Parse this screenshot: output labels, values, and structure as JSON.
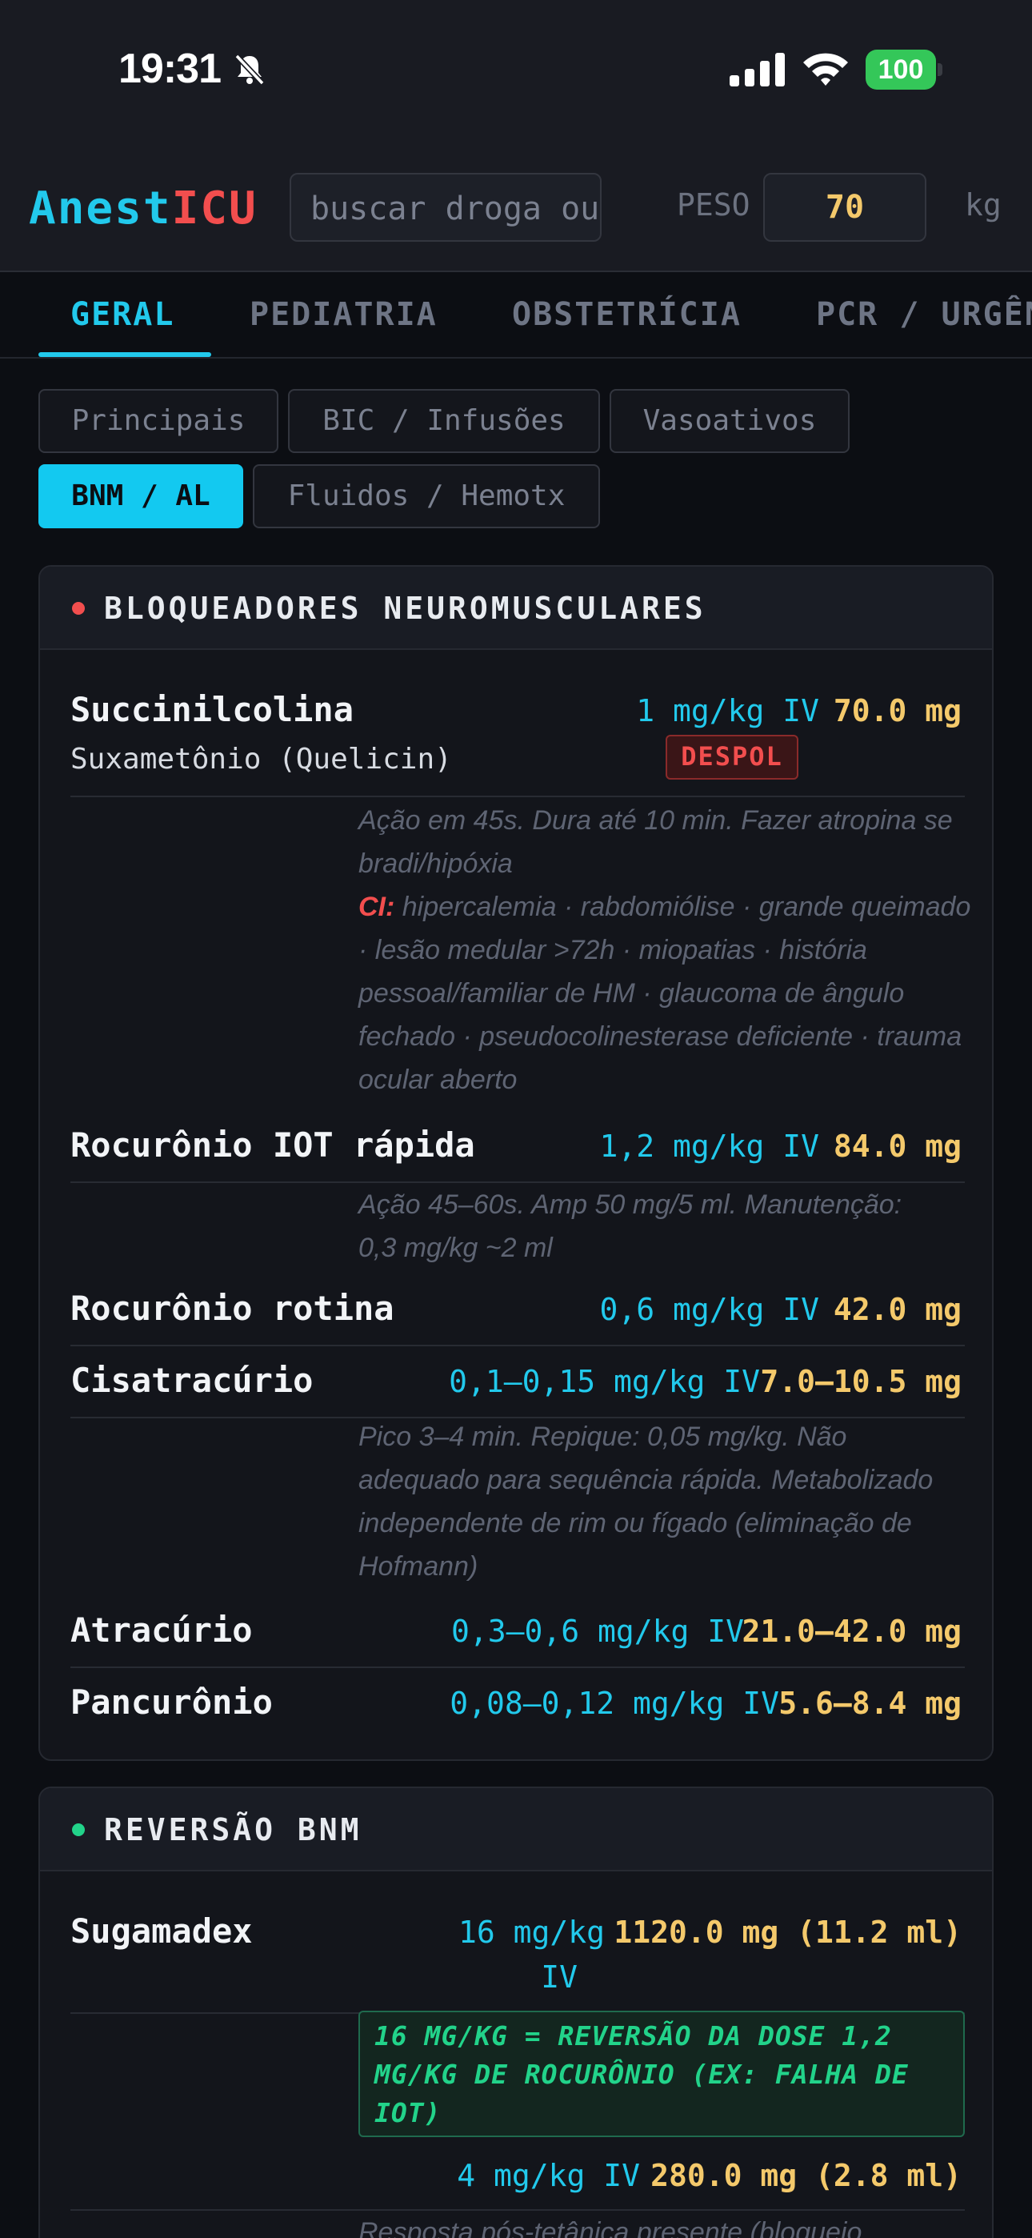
{
  "status_bar": {
    "time": "19:31",
    "battery": "100"
  },
  "header": {
    "logo_part1": "Anest",
    "logo_part2": "ICU",
    "search_placeholder": "buscar droga ou…",
    "weight_label": "PESO",
    "weight_value": "70",
    "weight_unit": "kg"
  },
  "tabs": [
    "GERAL",
    "PEDIATRIA",
    "OBSTETRÍCIA",
    "PCR / URGÊNCIA"
  ],
  "chips": [
    "Principais",
    "BIC / Infusões",
    "Vasoativos",
    "BNM / AL",
    "Fluidos / Hemotx"
  ],
  "active_chip": "BNM / AL",
  "colors": {
    "accent": "#22c9ec",
    "dose": "#f4c96b",
    "alert": "#f24e4e",
    "success": "#22d38a"
  },
  "sections": {
    "bnm": {
      "title": "BLOQUEADORES NEUROMUSCULARES",
      "dot_color": "#f24e4e",
      "drugs": {
        "succinilcolina": {
          "name": "Succinilcolina",
          "brand": "Suxametônio (Quelicin)",
          "dose": "1 mg/kg IV",
          "total": "70.0 mg",
          "badge": "DESPOL",
          "note": "Ação em 45s. Dura até 10 min. Fazer atropina se bradi/hipóxia",
          "ci_label": "CI:",
          "ci_text": " hipercalemia · rabdomiólise · grande queimado · lesão medular >72h · miopatias · história pessoal/familiar de HM · glaucoma de ângulo fechado · pseudocolinesterase deficiente · trauma ocular aberto"
        },
        "rocuronio_rapida": {
          "name": "Rocurônio IOT rápida",
          "dose": "1,2 mg/kg IV",
          "total": "84.0 mg",
          "note": "Ação 45–60s. Amp 50 mg/5 ml. Manutenção: 0,3 mg/kg ~2 ml"
        },
        "rocuronio_rotina": {
          "name": "Rocurônio rotina",
          "dose": "0,6 mg/kg IV",
          "total": "42.0 mg"
        },
        "cisatracurio": {
          "name": "Cisatracúrio",
          "dose": "0,1–0,15 mg/kg IV",
          "total": "7.0–10.5 mg",
          "note": "Pico 3–4 min. Repique: 0,05 mg/kg. Não adequado para sequência rápida. Metabolizado independente de rim ou fígado (eliminação de Hofmann)"
        },
        "atracurio": {
          "name": "Atracúrio",
          "dose": "0,3–0,6 mg/kg IV",
          "total": "21.0–42.0 mg"
        },
        "pancuronio": {
          "name": "Pancurônio",
          "dose": "0,08–0,12 mg/kg IV",
          "total": "5.6–8.4 mg"
        }
      }
    },
    "reversao": {
      "title": "REVERSÃO BNM",
      "dot_color": "#22d38a",
      "sugamadex": {
        "name": "Sugamadex",
        "dose1": "16 mg/kg",
        "dose1_route": "IV",
        "total1": "1120.0 mg (11.2 ml)",
        "highlight": "16 MG/KG = REVERSÃO DA DOSE 1,2 MG/KG DE ROCURÔNIO (EX: FALHA DE IOT)",
        "dose2": "4 mg/kg IV",
        "total2": "280.0 mg (2.8 ml)",
        "note": "Resposta pós-tetânica presente (bloqueio"
      }
    }
  }
}
